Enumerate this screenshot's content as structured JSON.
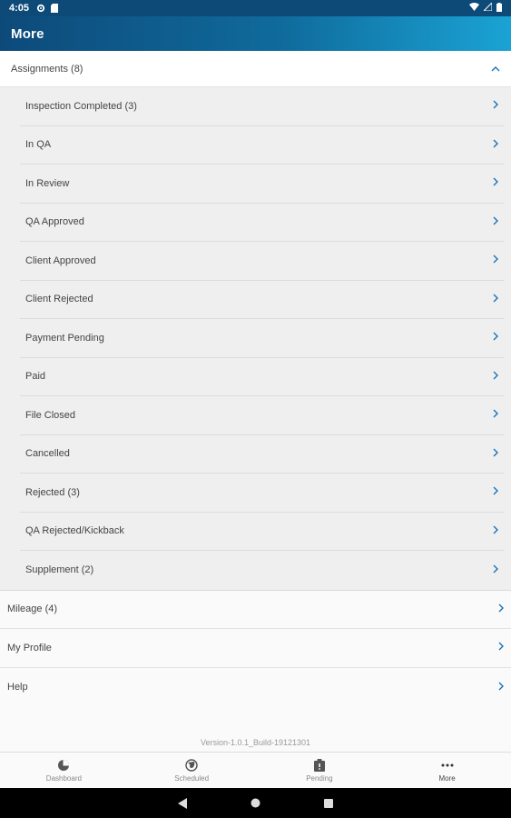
{
  "status_bar": {
    "time": "4:05"
  },
  "app_bar": {
    "title": "More"
  },
  "assignments": {
    "label": "Assignments (8)",
    "items": [
      {
        "label": "Inspection Completed (3)"
      },
      {
        "label": "In QA"
      },
      {
        "label": "In Review"
      },
      {
        "label": "QA Approved"
      },
      {
        "label": "Client Approved"
      },
      {
        "label": "Client Rejected"
      },
      {
        "label": "Payment Pending"
      },
      {
        "label": "Paid"
      },
      {
        "label": "File Closed"
      },
      {
        "label": "Cancelled"
      },
      {
        "label": "Rejected (3)"
      },
      {
        "label": "QA Rejected/Kickback"
      },
      {
        "label": "Supplement (2)"
      }
    ]
  },
  "menu": {
    "mileage": "Mileage (4)",
    "profile": "My Profile",
    "help": "Help"
  },
  "version": "Version-1.0.1_Build-19121301",
  "bottom_nav": {
    "dashboard": "Dashboard",
    "scheduled": "Scheduled",
    "pending": "Pending",
    "more": "More"
  },
  "colors": {
    "app_bar_start": "#0d4a7a",
    "app_bar_end": "#1aa3d4",
    "accent": "#1a73b8"
  }
}
